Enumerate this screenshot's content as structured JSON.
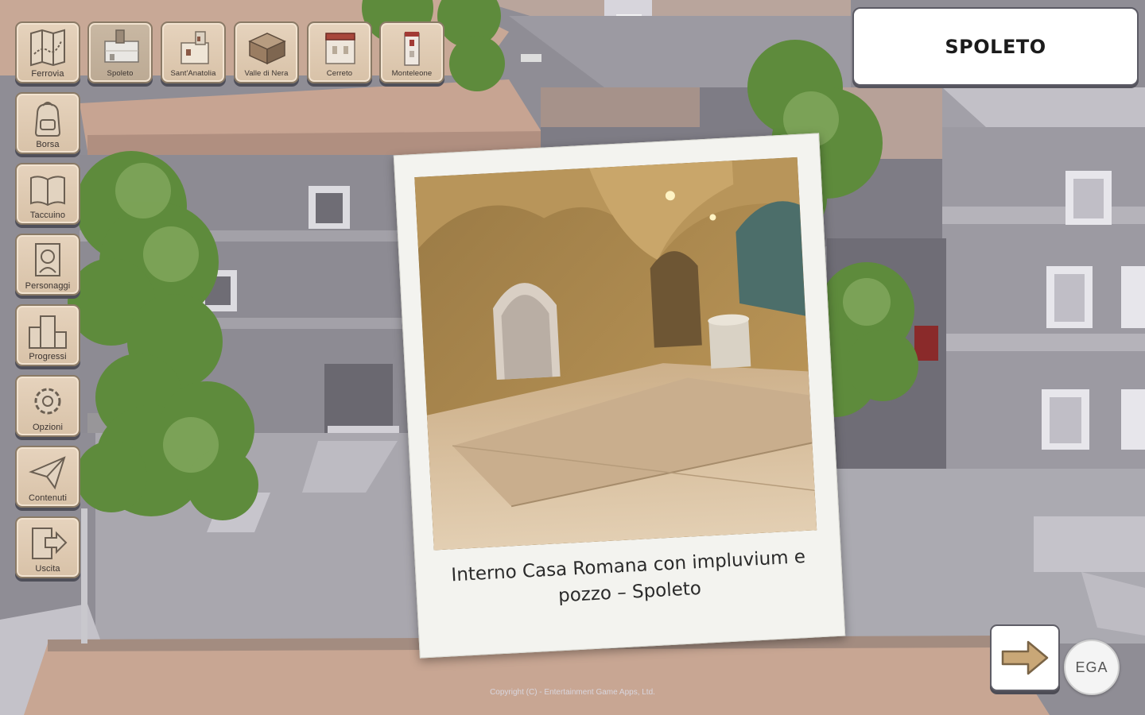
{
  "toolbar_top": [
    {
      "label": "Ferrovia",
      "icon": "map-icon",
      "active": false
    },
    {
      "label": "Spoleto",
      "icon": "spoleto-building-icon",
      "active": true
    },
    {
      "label": "Sant'Anatolia",
      "icon": "santanatolia-building-icon",
      "active": false
    },
    {
      "label": "Valle di Nera",
      "icon": "vallo-di-nera-building-icon",
      "active": false
    },
    {
      "label": "Cerreto",
      "icon": "cerreto-building-icon",
      "active": false
    },
    {
      "label": "Monteleone",
      "icon": "monteleone-building-icon",
      "active": false
    }
  ],
  "toolbar_side": [
    {
      "label": "Borsa",
      "icon": "backpack-icon"
    },
    {
      "label": "Taccuino",
      "icon": "notebook-icon"
    },
    {
      "label": "Personaggi",
      "icon": "character-portrait-icon"
    },
    {
      "label": "Progressi",
      "icon": "progress-podium-icon"
    },
    {
      "label": "Opzioni",
      "icon": "gear-icon"
    },
    {
      "label": "Contenuti",
      "icon": "paper-plane-icon"
    },
    {
      "label": "Uscita",
      "icon": "exit-icon"
    }
  ],
  "city_name": "SPOLETO",
  "photo_card": {
    "caption_line1": "Interno Casa Romana con impluvium e",
    "caption_line2": "pozzo – Spoleto"
  },
  "next_button_icon": "arrow-right-icon",
  "ega_logo_text": "EGA",
  "copyright": "Copyright (C) - Entertainment Game Apps, Ltd.",
  "colors": {
    "button_face": "#e6d3bd",
    "roof": "#c9a591",
    "wall": "#8e8c94",
    "tree": "#5f8a3e",
    "arrow": "#c9a777"
  }
}
